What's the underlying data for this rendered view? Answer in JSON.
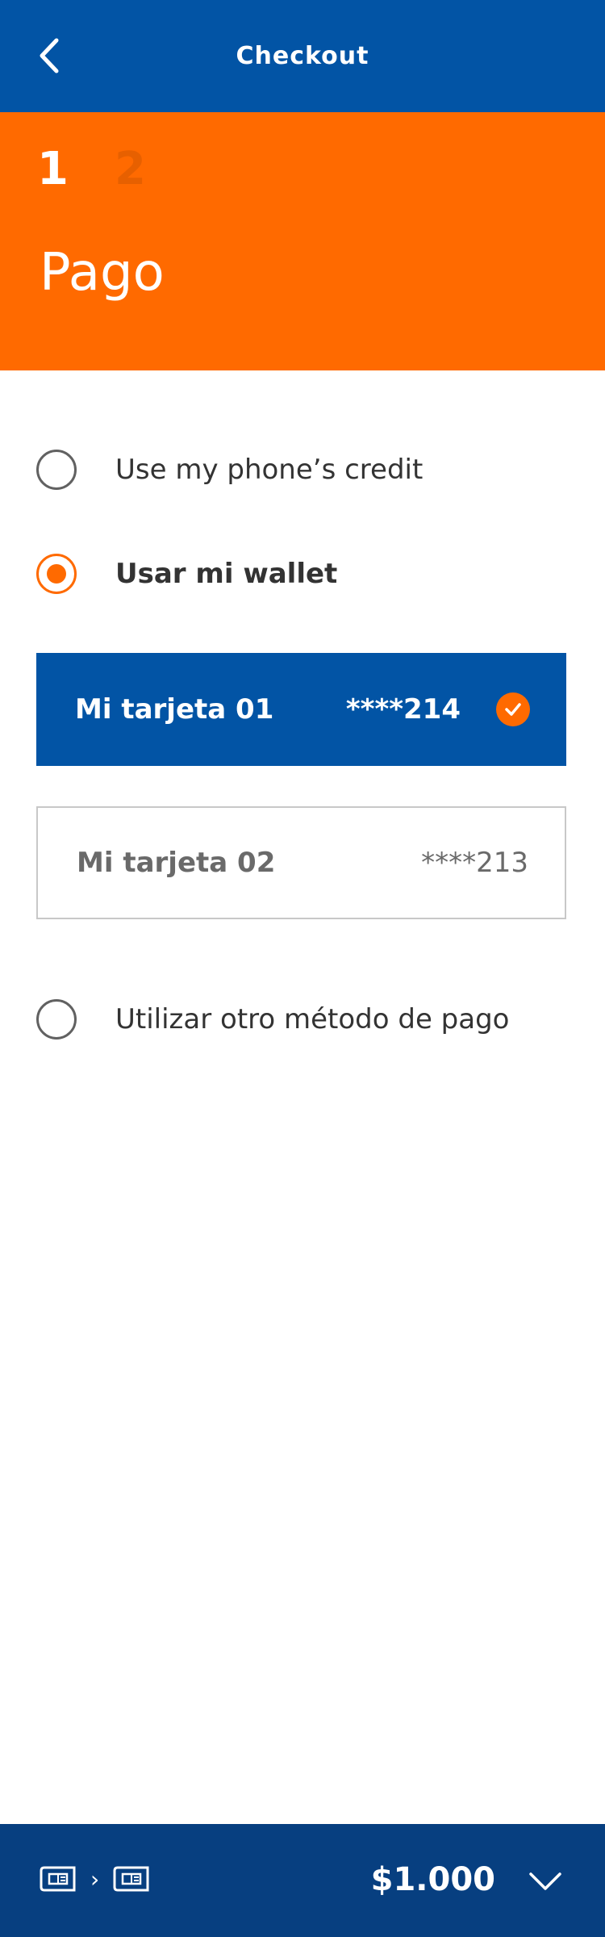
{
  "header": {
    "title": "Checkout",
    "back_icon": "chevron-left-icon"
  },
  "steps": {
    "current": "1",
    "next": "2",
    "section_title": "Pago"
  },
  "payment": {
    "options": [
      {
        "label": "Use my phone’s credit",
        "selected": false
      },
      {
        "label": "Usar mi wallet",
        "selected": true
      },
      {
        "label": "Utilizar otro método de pago",
        "selected": false
      }
    ],
    "cards": [
      {
        "name": "Mi tarjeta 01",
        "number": "****214",
        "selected": true
      },
      {
        "name": "Mi tarjeta 02",
        "number": "****213",
        "selected": false
      }
    ]
  },
  "footer": {
    "amount": "$1.000",
    "flow_icons": [
      "card-icon",
      "chevron-right-icon",
      "card-icon"
    ],
    "expand_icon": "chevron-down-icon"
  },
  "colors": {
    "primary_blue": "#0254a5",
    "dark_blue": "#073f80",
    "accent_orange": "#ff6a00"
  }
}
